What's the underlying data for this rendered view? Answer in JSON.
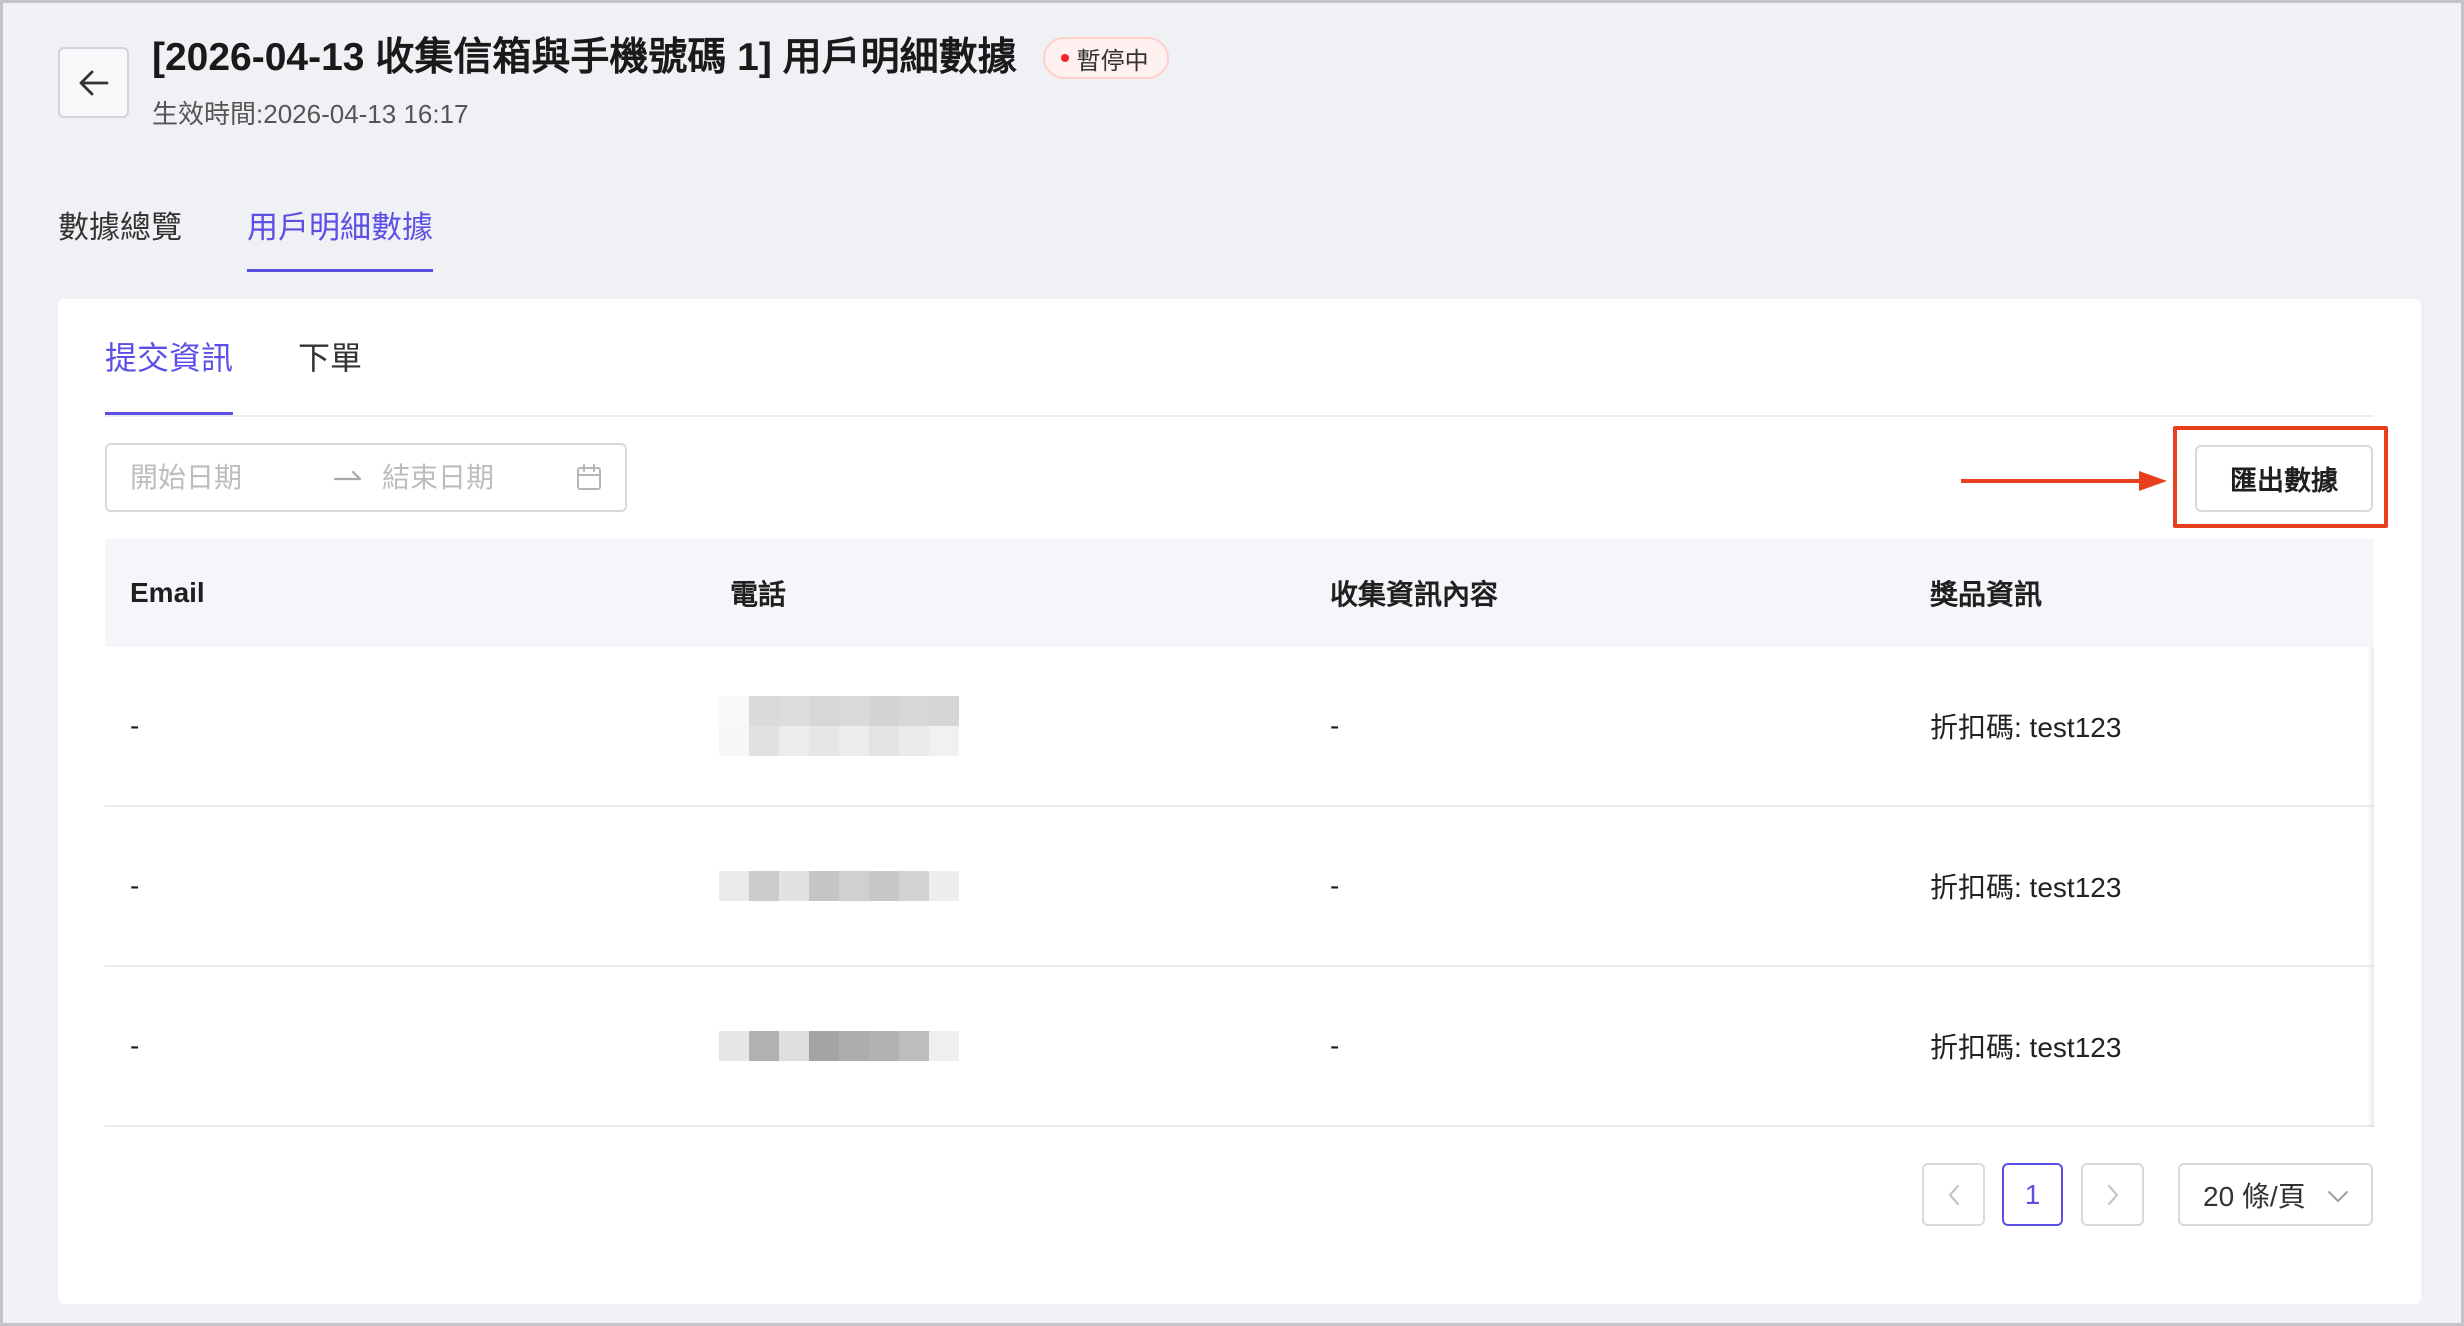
{
  "theme": {
    "accent": "#5b50e6",
    "page_bg": "#f0f1f5",
    "annotation": "#e8401c",
    "status_dot": "#f5222d"
  },
  "header": {
    "back_icon": "arrow-left-icon",
    "title": "[2026-04-13 收集信箱與手機號碼 1] 用戶明細數據",
    "status_badge": "暫停中",
    "effective_label": "生效時間:",
    "effective_time": "2026-04-13 16:17"
  },
  "main_tabs": [
    {
      "label": "數據總覽",
      "active": false
    },
    {
      "label": "用戶明細數據",
      "active": true
    }
  ],
  "sub_tabs": [
    {
      "label": "提交資訊",
      "active": true
    },
    {
      "label": "下單",
      "active": false
    }
  ],
  "date_range": {
    "start_placeholder": "開始日期",
    "end_placeholder": "結束日期",
    "separator_icon": "swap-right-icon",
    "suffix_icon": "calendar-icon"
  },
  "toolbar": {
    "export_label": "匯出數據",
    "annotation_icon": "arrow-right-icon"
  },
  "table": {
    "columns": [
      "Email",
      "電話",
      "收集資訊內容",
      "獎品資訊"
    ],
    "rows": [
      {
        "email": "-",
        "phone_pixels": [
          [
            "#f8f8f8",
            "#dadada",
            "#dcdcdc",
            "#d7d7d7",
            "#d9d9d9",
            "#d4d4d4",
            "#d8d8d8",
            "#d6d6d6"
          ],
          [
            "#f7f7f7",
            "#e1e1e1",
            "#ececec",
            "#e6e6e6",
            "#ededed",
            "#e3e3e3",
            "#eaeaea",
            "#f1f1f1"
          ]
        ],
        "content": "-",
        "prize": "折扣碼: test123"
      },
      {
        "email": "-",
        "phone_pixels": [
          [
            "#ebebeb",
            "#cbcbcb",
            "#e2e2e2",
            "#c5c5c5",
            "#d0d0d0",
            "#c8c8c8",
            "#d3d3d3",
            "#eeeeee"
          ]
        ],
        "content": "-",
        "prize": "折扣碼: test123"
      },
      {
        "email": "-",
        "phone_pixels": [
          [
            "#e6e6e6",
            "#b1b1b1",
            "#dedede",
            "#a4a4a4",
            "#adadad",
            "#b2b2b2",
            "#bdbdbd",
            "#efefef"
          ]
        ],
        "content": "-",
        "prize": "折扣碼: test123"
      }
    ]
  },
  "pagination": {
    "prev_icon": "chevron-left-icon",
    "current_page": "1",
    "next_icon": "chevron-right-icon",
    "page_size": "20 條/頁",
    "page_size_icon": "chevron-down-icon"
  }
}
